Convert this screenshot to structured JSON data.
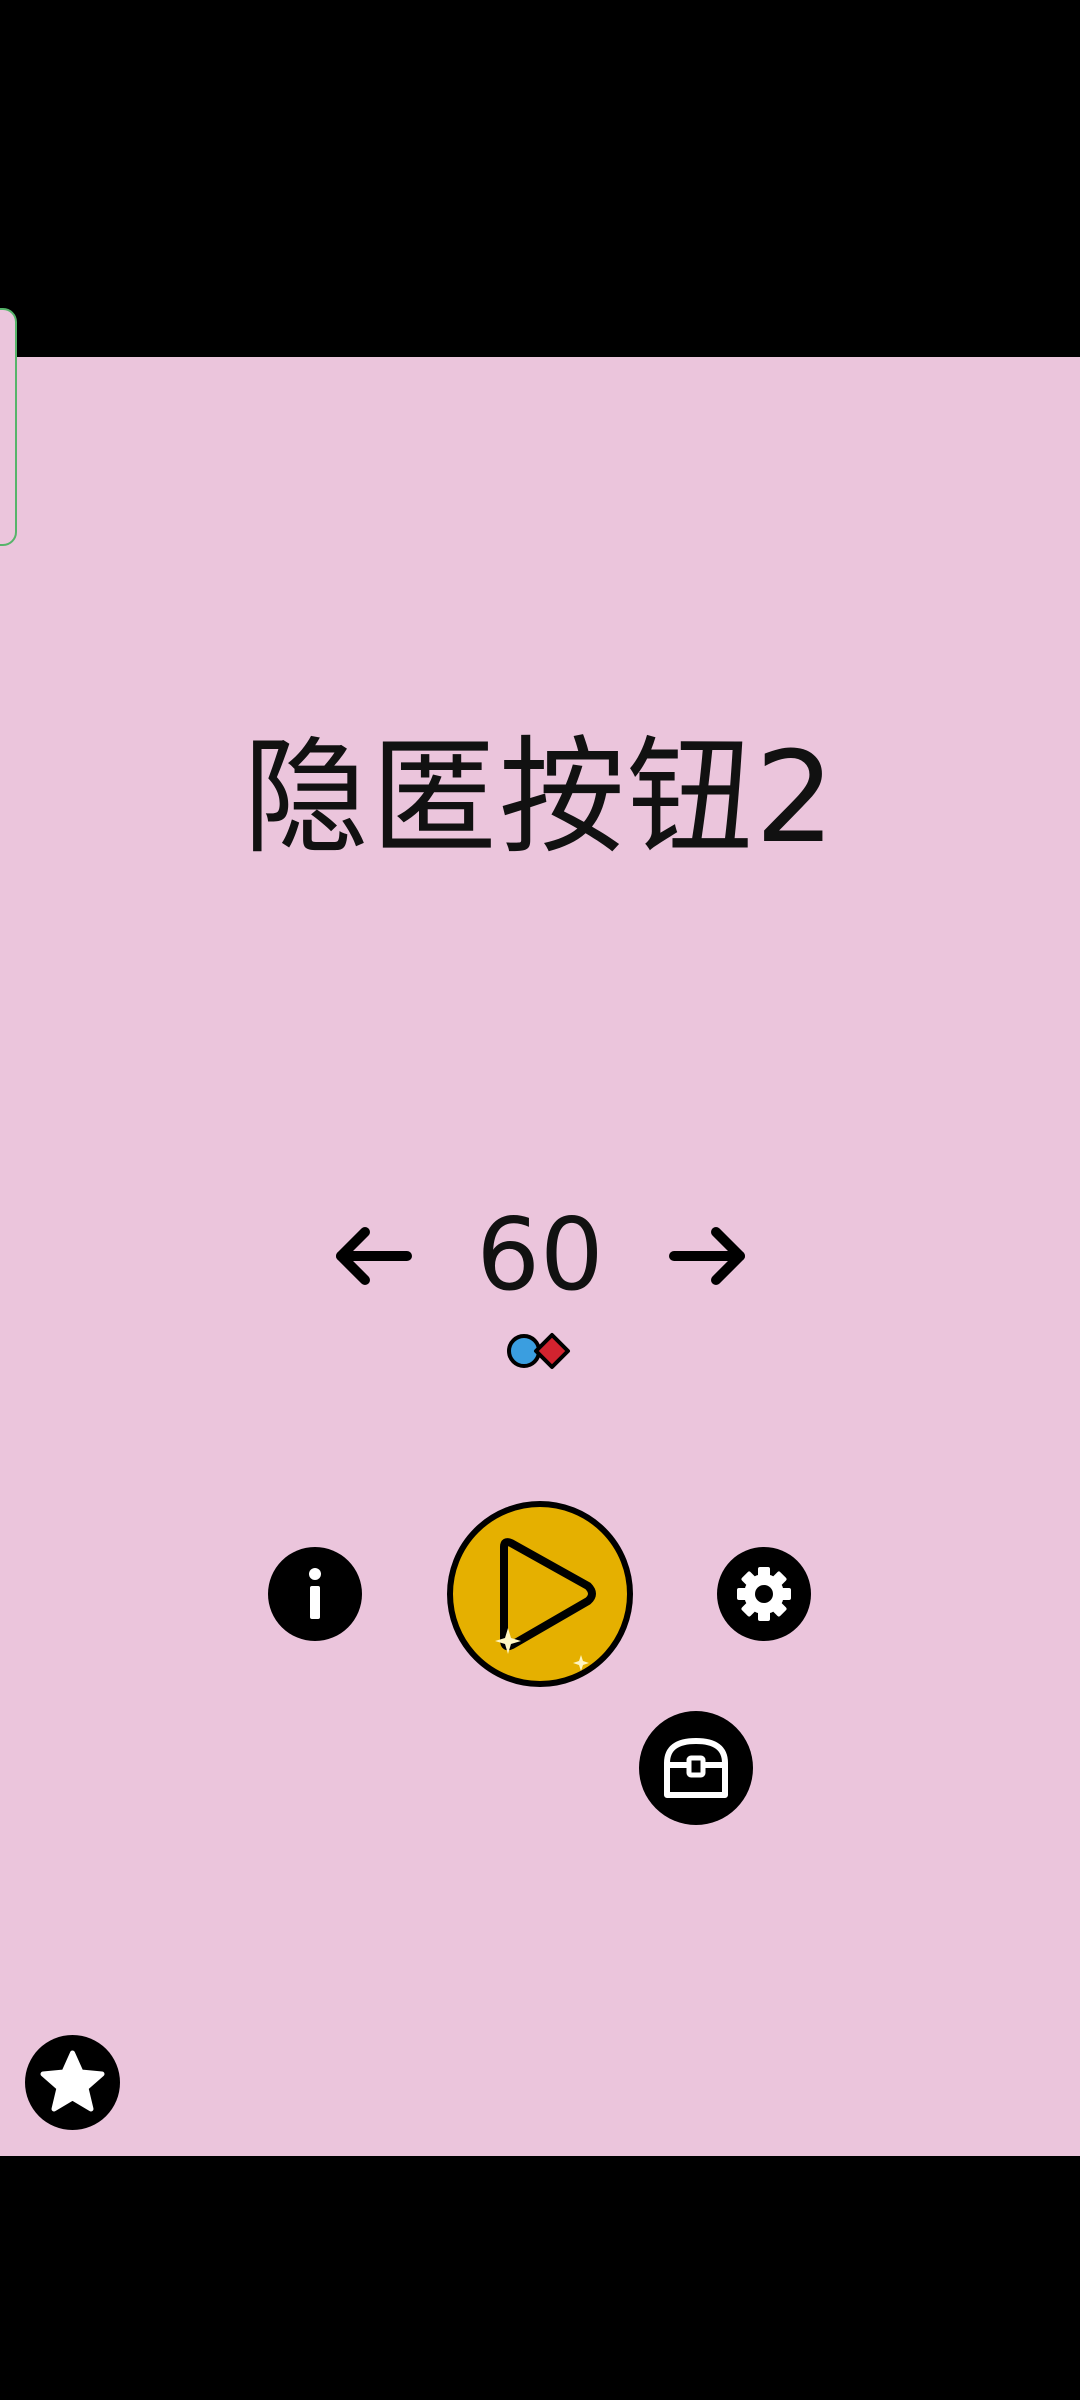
{
  "title": "隐匿按钮2",
  "level": {
    "number": "60",
    "prev_icon": "arrow-left-icon",
    "next_icon": "arrow-right-icon",
    "gems_icon": "gems-icon"
  },
  "buttons": {
    "info_icon": "info-icon",
    "play_icon": "play-icon",
    "settings_icon": "gear-icon",
    "chest_icon": "treasure-chest-icon",
    "star_icon": "star-icon"
  },
  "colors": {
    "background": "#ebc5dc",
    "play_button": "#e5b000",
    "button_fill": "#000000",
    "gem_blue": "#3a9ee0",
    "gem_red": "#d2232f",
    "side_handle_border": "#56b46a"
  }
}
